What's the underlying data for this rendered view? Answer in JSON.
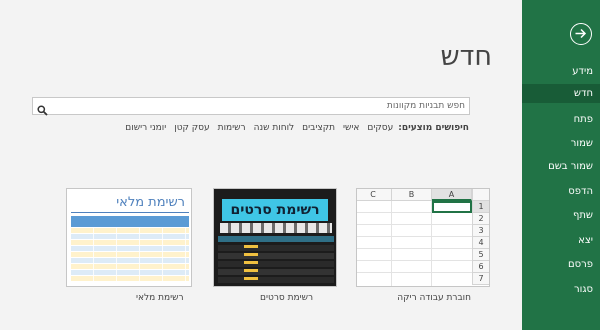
{
  "nav": {
    "back_label": "",
    "items": [
      {
        "id": "info",
        "label": "מידע",
        "selected": false
      },
      {
        "id": "new",
        "label": "חדש",
        "selected": true
      },
      {
        "id": "open",
        "label": "פתח",
        "selected": false
      },
      {
        "id": "save",
        "label": "שמור",
        "selected": false
      },
      {
        "id": "save_as",
        "label": "שמור בשם",
        "selected": false
      },
      {
        "id": "print",
        "label": "הדפס",
        "selected": false
      },
      {
        "id": "share",
        "label": "שתף",
        "selected": false
      },
      {
        "id": "export",
        "label": "יצא",
        "selected": false
      },
      {
        "id": "publish",
        "label": "פרסם",
        "selected": false
      },
      {
        "id": "close",
        "label": "סגור",
        "selected": false
      }
    ]
  },
  "main": {
    "title": "חדש",
    "search": {
      "placeholder": "חפש תבניות מקוונות",
      "value": ""
    },
    "suggested": {
      "label": "חיפושים מוצעים:",
      "links": [
        "עסקים",
        "אישי",
        "תקציבים",
        "לוחות שנה",
        "רשימות",
        "עסק קטן",
        "יומני רישום"
      ]
    },
    "templates": [
      {
        "id": "blank",
        "caption": "חוברת עבודה ריקה",
        "columns": [
          "A",
          "B",
          "C"
        ],
        "rows": [
          "1",
          "2",
          "3",
          "4",
          "5",
          "6",
          "7"
        ]
      },
      {
        "id": "movie",
        "caption": "רשימת סרטים",
        "thumb_title": "רשימת סרטים"
      },
      {
        "id": "inventory",
        "caption": "רשימת מלאי",
        "thumb_title": "רשימת מלאי"
      }
    ]
  },
  "colors": {
    "nav_bg": "#217346",
    "nav_selected": "#185c37",
    "accent_cell": "#217346",
    "movie_banner": "#3fc6e6",
    "inventory_header": "#5b9bd5"
  },
  "icons": {
    "back": "arrow-circle-icon",
    "search": "search-icon"
  }
}
